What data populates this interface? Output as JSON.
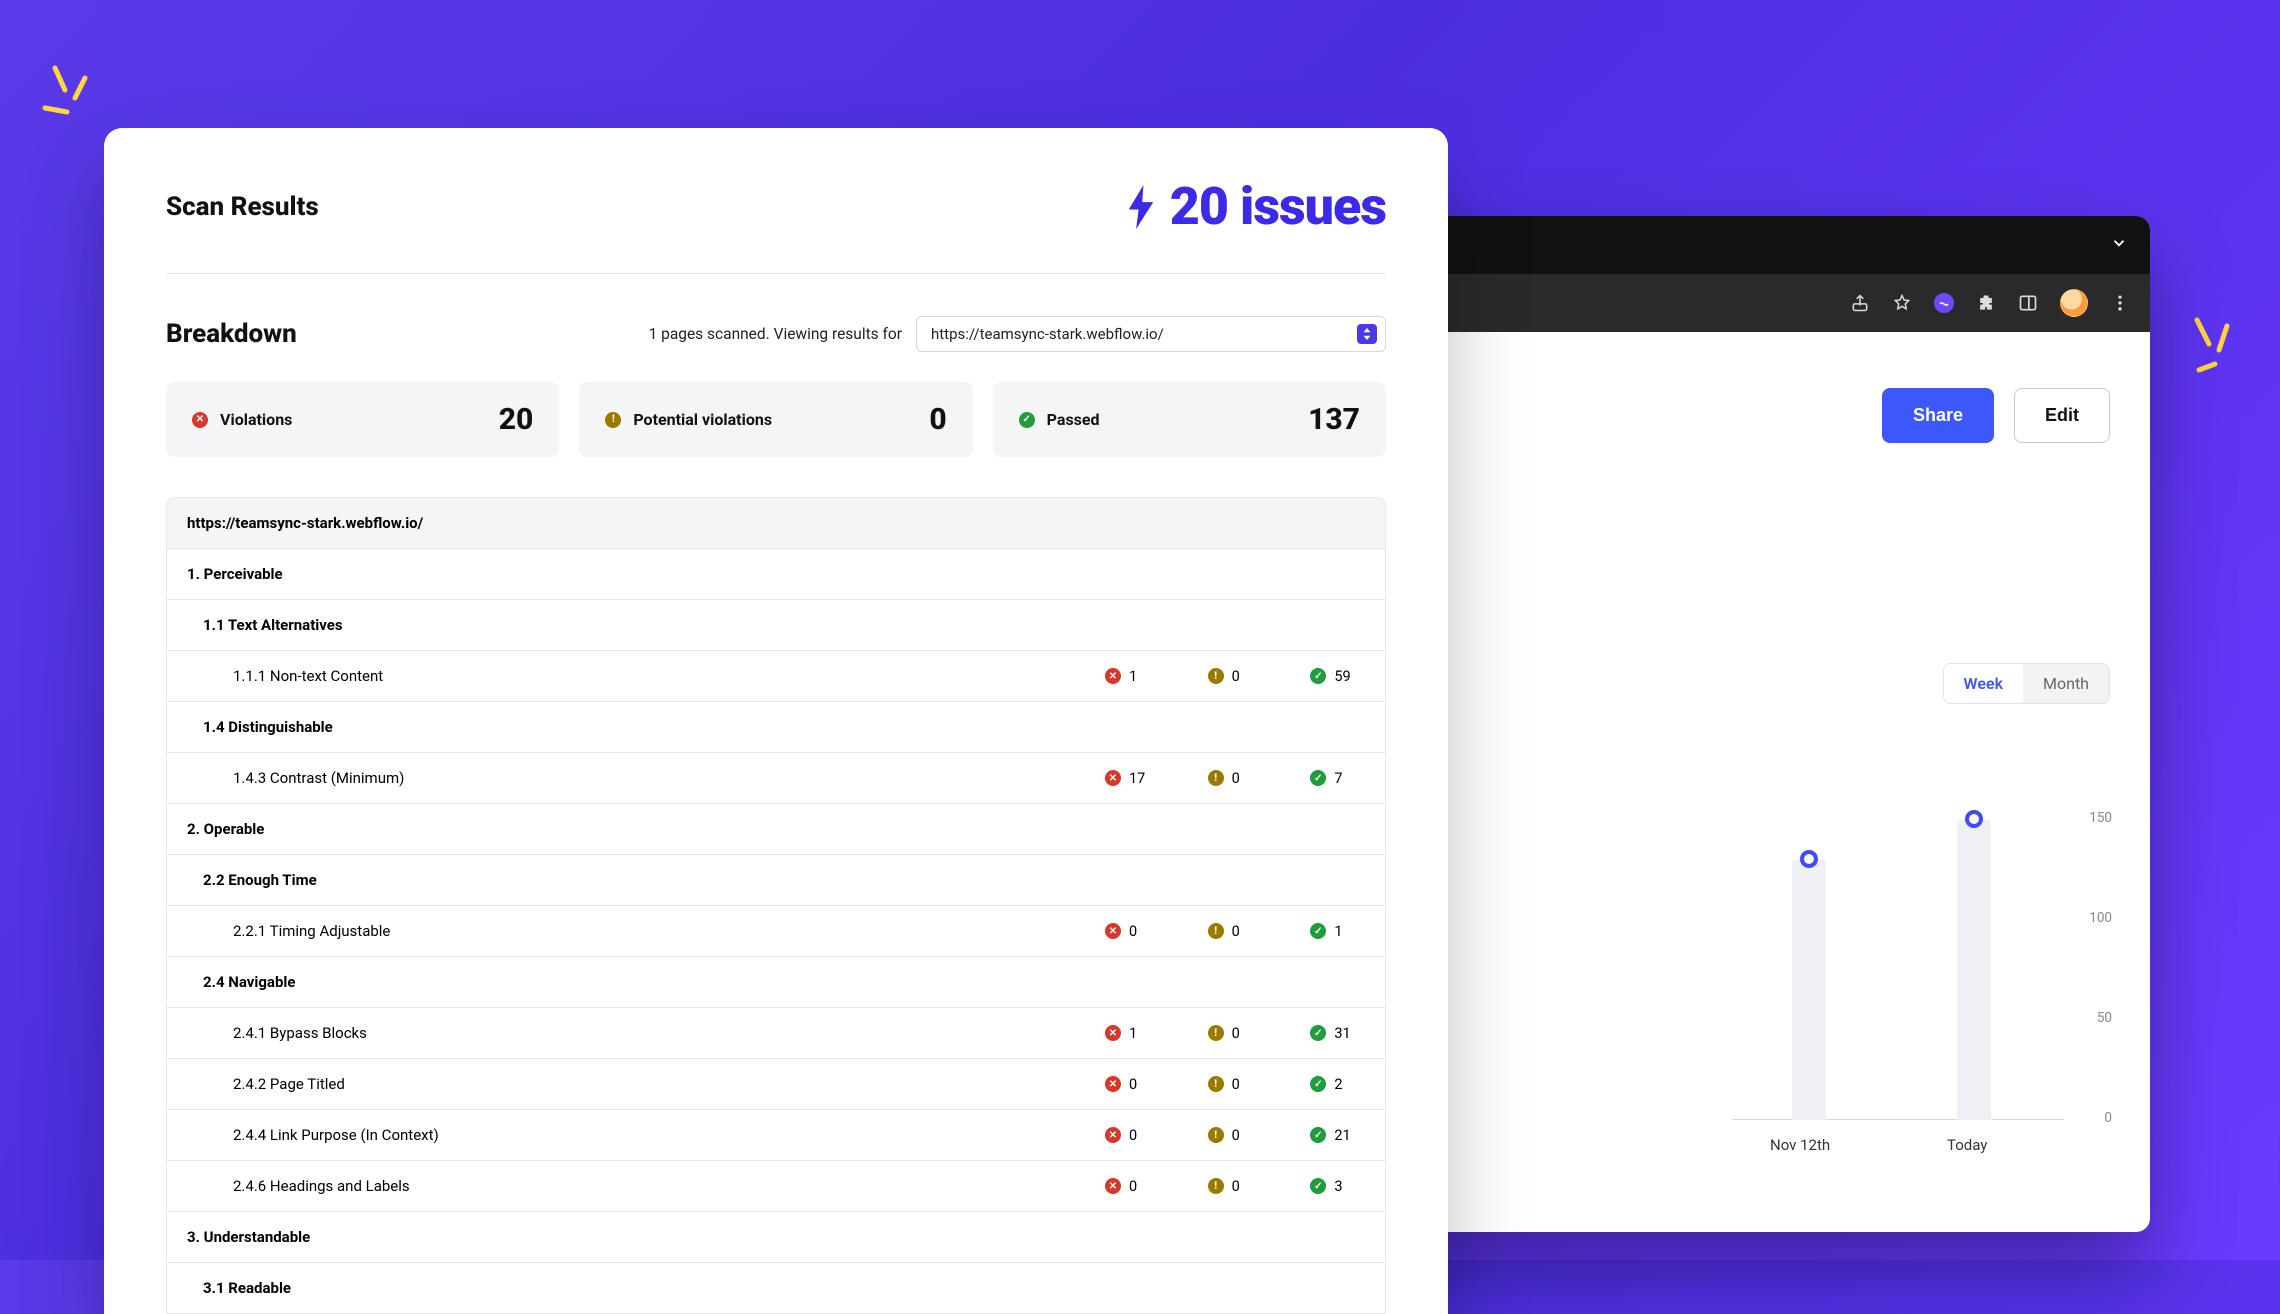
{
  "scan": {
    "title": "Scan Results",
    "issues_label": "20 issues",
    "breakdown_title": "Breakdown",
    "meta_text": "1 pages scanned. Viewing results for",
    "selected_url": "https://teamsync-stark.webflow.io/",
    "summary": {
      "violations_label": "Violations",
      "violations_value": "20",
      "potential_label": "Potential violations",
      "potential_value": "0",
      "passed_label": "Passed",
      "passed_value": "137"
    },
    "table": {
      "url_header": "https://teamsync-stark.webflow.io/",
      "rows": [
        {
          "type": "principle",
          "label": "1. Perceivable"
        },
        {
          "type": "guideline",
          "label": "1.1 Text Alternatives"
        },
        {
          "type": "criterion",
          "label": "1.1.1 Non-text Content",
          "v": "1",
          "p": "0",
          "pa": "59"
        },
        {
          "type": "guideline",
          "label": "1.4 Distinguishable"
        },
        {
          "type": "criterion",
          "label": "1.4.3 Contrast (Minimum)",
          "v": "17",
          "p": "0",
          "pa": "7"
        },
        {
          "type": "principle",
          "label": "2. Operable"
        },
        {
          "type": "guideline",
          "label": "2.2 Enough Time"
        },
        {
          "type": "criterion",
          "label": "2.2.1 Timing Adjustable",
          "v": "0",
          "p": "0",
          "pa": "1"
        },
        {
          "type": "guideline",
          "label": "2.4 Navigable"
        },
        {
          "type": "criterion",
          "label": "2.4.1 Bypass Blocks",
          "v": "1",
          "p": "0",
          "pa": "31"
        },
        {
          "type": "criterion",
          "label": "2.4.2 Page Titled",
          "v": "0",
          "p": "0",
          "pa": "2"
        },
        {
          "type": "criterion",
          "label": "2.4.4 Link Purpose (In Context)",
          "v": "0",
          "p": "0",
          "pa": "21"
        },
        {
          "type": "criterion",
          "label": "2.4.6 Headings and Labels",
          "v": "0",
          "p": "0",
          "pa": "3"
        },
        {
          "type": "principle",
          "label": "3. Understandable"
        },
        {
          "type": "guideline",
          "label": "3.1 Readable"
        }
      ]
    }
  },
  "browser": {
    "share_label": "Share",
    "edit_label": "Edit",
    "segment_week": "Week",
    "segment_month": "Month"
  },
  "chart_data": {
    "type": "bar",
    "categories": [
      "Nov 12th",
      "Today"
    ],
    "values": [
      130,
      150
    ],
    "ylim": [
      0,
      150
    ],
    "yticks": [
      "0",
      "50",
      "100",
      "150"
    ],
    "title": "",
    "xlabel": "",
    "ylabel": ""
  }
}
